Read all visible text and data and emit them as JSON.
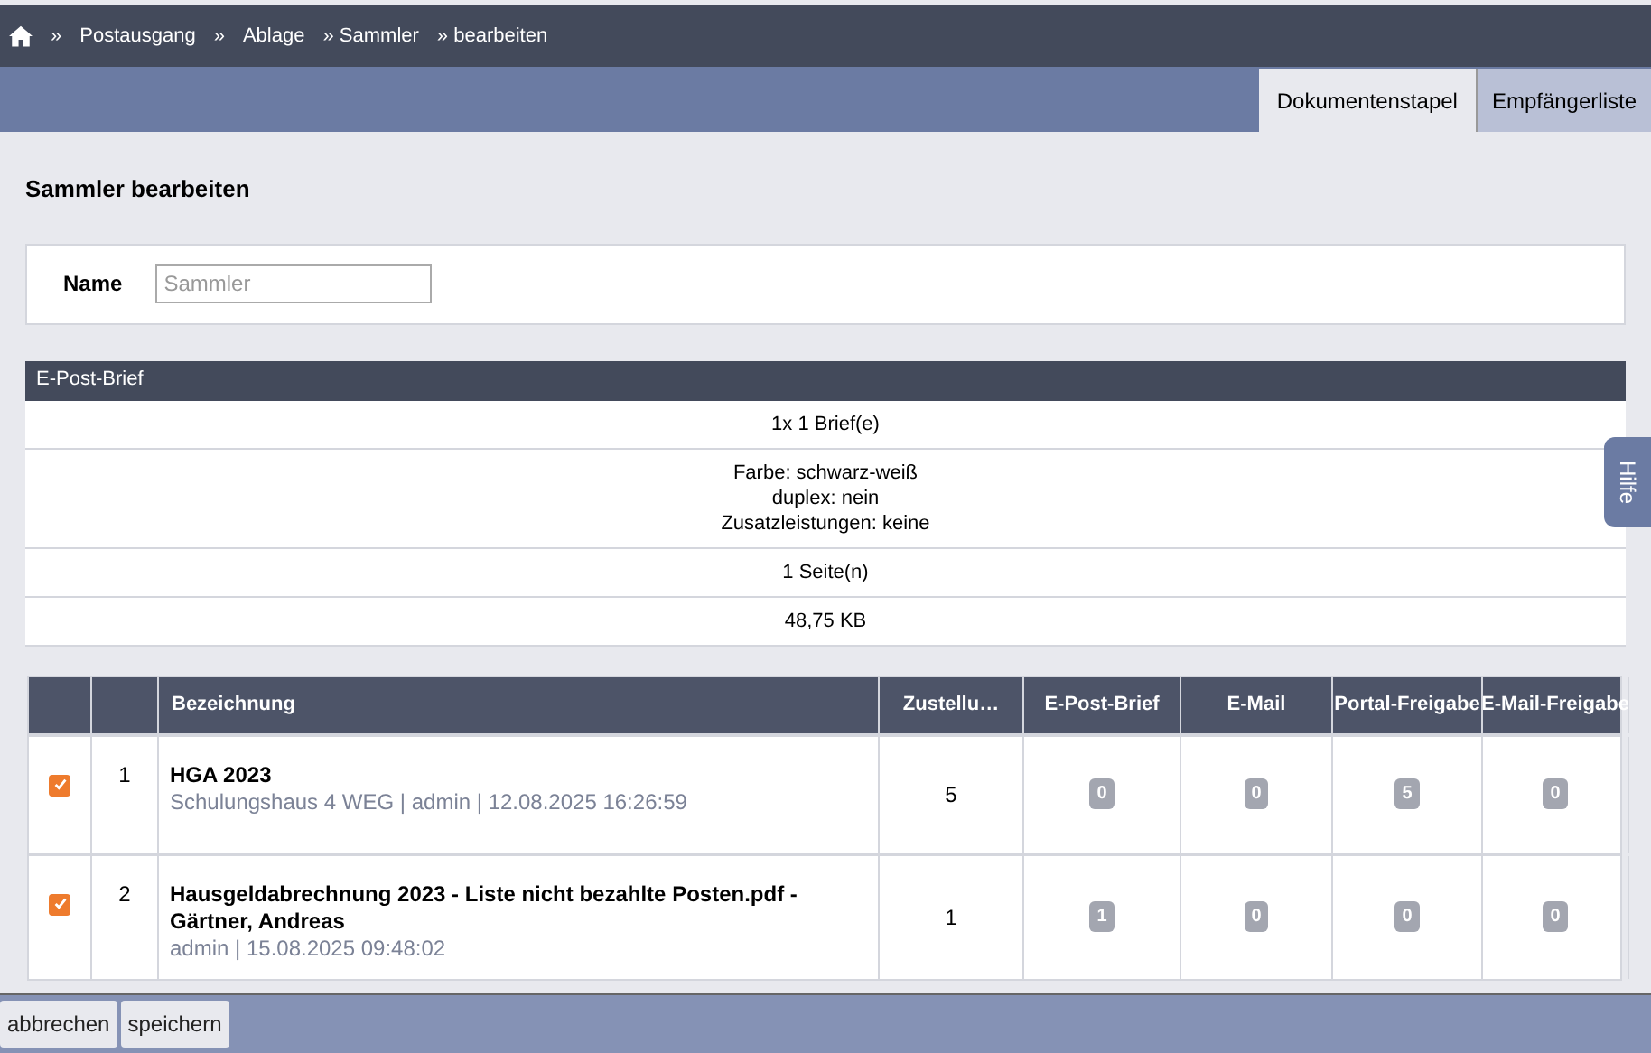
{
  "breadcrumb": [
    {
      "label": "»"
    },
    {
      "label": "Postausgang"
    },
    {
      "label": "»"
    },
    {
      "label": "Ablage"
    },
    {
      "label": "» Sammler"
    },
    {
      "label": "» bearbeiten"
    }
  ],
  "tabs": [
    {
      "label": "Dokumentenstapel",
      "selected": true
    },
    {
      "label": "Empfängerliste",
      "selected": false
    }
  ],
  "title": "Sammler bearbeiten",
  "name_field": {
    "label": "Name",
    "placeholder": "Sammler"
  },
  "summary": {
    "title": "E-Post-Brief",
    "rows": [
      [
        "1x 1 Brief(e)"
      ],
      [
        "Farbe: schwarz-weiß",
        "duplex: nein",
        "Zusatzleistungen: keine"
      ],
      [
        "1 Seite(n)"
      ],
      [
        "48,75 KB"
      ]
    ]
  },
  "help_tab": "Hilfe",
  "documents": {
    "columns": [
      "Bezeichnung",
      "Zustellu…",
      "E-Post-Brief",
      "E-Mail",
      "Portal-Freigabe",
      "E-Mail-Freigabe"
    ],
    "rows": [
      {
        "checked": true,
        "number": "1",
        "title": "HGA 2023",
        "meta": "Schulungshaus 4 WEG | admin | 12.08.2025 16:26:59",
        "count": "5",
        "badges": [
          "0",
          "0",
          "5",
          "0"
        ]
      },
      {
        "checked": true,
        "number": "2",
        "title": "Hausgeldabrechnung 2023 - Liste nicht bezahlte Posten.pdf - Gärtner, Andreas",
        "meta": "admin | 15.08.2025 09:48:02",
        "count": "1",
        "badges": [
          "1",
          "0",
          "0",
          "0"
        ]
      }
    ]
  },
  "buttons": [
    "abbrechen",
    "speichern"
  ]
}
